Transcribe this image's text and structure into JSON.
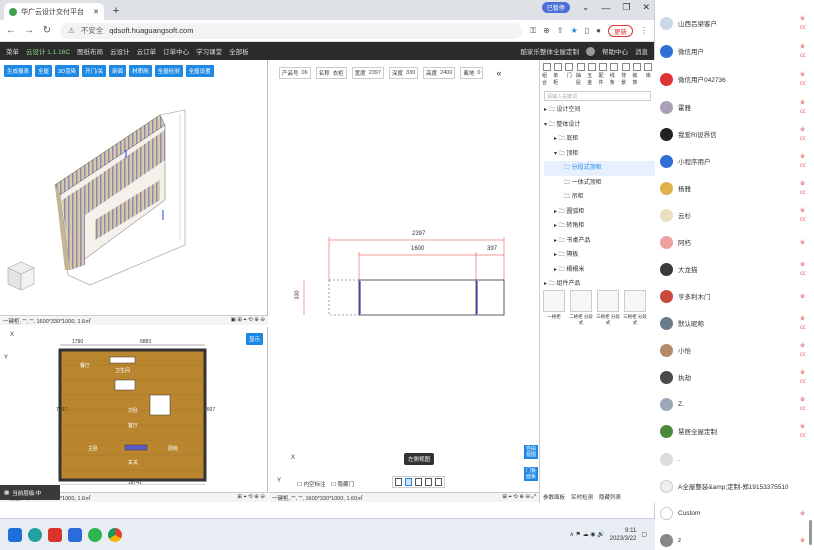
{
  "browser": {
    "tab_title": "华广云设计交付平台",
    "new_tab": "+",
    "url_security": "不安全",
    "url": "qdsoft.huaguangsoft.com",
    "update_label": "更新",
    "profile_label": "已暂停",
    "minimize": "—",
    "restore": "❐",
    "close": "✕"
  },
  "appbar": {
    "menu": "菜单",
    "version": "云设计 1.1.16C",
    "items": [
      "图纸布局",
      "云设计",
      "云订单",
      "订单中心",
      "学习课堂",
      "全部板"
    ],
    "right_items": [
      "酷家乐整体全屋定制",
      "帮助中心",
      "消息"
    ]
  },
  "toolbar3d": [
    "生成报表",
    "全屋",
    "3D渲染",
    "开门/关",
    "剖面",
    "材质刷",
    "全屋检测",
    "全屋设置"
  ],
  "coord_bar": {
    "left": "一键柜, \"\", \"\", 1600*330*1000,  1.6㎡",
    "left2": "一键柜, \"\", \"\", 1600*330*1000,  1.60㎡"
  },
  "plan2d": {
    "dim_top": "1790",
    "dim_top2": "6883",
    "dim_left": "7607",
    "dim_right": "7607",
    "dim_bottom": "18741",
    "rooms": [
      "餐厅",
      "卫生间",
      "次卧",
      "客厅",
      "主卧",
      "厨房",
      "玄关"
    ],
    "toggle_label": "显示"
  },
  "params": {
    "fields": [
      {
        "label": "产品号",
        "value": "06"
      },
      {
        "label": "名称",
        "value": "衣柜"
      },
      {
        "label": "宽度",
        "value": "2397"
      },
      {
        "label": "深度",
        "value": "330"
      },
      {
        "label": "高度",
        "value": "2400"
      },
      {
        "label": "离地",
        "value": "0"
      }
    ]
  },
  "elevation": {
    "dim_total": "2397",
    "dim_a": "1600",
    "dim_b": "397",
    "dim_height": "330",
    "axis_x": "X",
    "axis_y": "Y",
    "check_inner": "内空标注",
    "check_hidden": "隐藏门",
    "tooltip": "左侧视图"
  },
  "right_panel": {
    "categories": [
      "组合",
      "单柜",
      "门",
      "抽屉",
      "五金",
      "配件",
      "线条",
      "背景",
      "装饰",
      "库"
    ],
    "search_placeholder": "请输入关键词",
    "tree": [
      {
        "label": "设计空间",
        "level": 1,
        "selected": false
      },
      {
        "label": "整体设计",
        "level": 1,
        "selected": false
      },
      {
        "label": "底柜",
        "level": 2,
        "selected": false
      },
      {
        "label": "顶柜",
        "level": 2,
        "selected": false
      },
      {
        "label": "分段式顶柜",
        "level": 3,
        "selected": true
      },
      {
        "label": "一体式顶柜",
        "level": 3,
        "selected": false
      },
      {
        "label": "吊柜",
        "level": 3,
        "selected": false
      },
      {
        "label": "圆弧柜",
        "level": 2,
        "selected": false
      },
      {
        "label": "转角柜",
        "level": 2,
        "selected": false
      },
      {
        "label": "书桌产品",
        "level": 2,
        "selected": false
      },
      {
        "label": "隔板",
        "level": 2,
        "selected": false
      },
      {
        "label": "榻榻米",
        "level": 2,
        "selected": false
      },
      {
        "label": "组件产品",
        "level": 1,
        "selected": false
      }
    ],
    "thumbs": [
      "一格柜",
      "二格柜 分段式",
      "三格柜 分段式",
      "三格柜 分段式"
    ],
    "bottom_links": [
      "参数面板",
      "实时检测",
      "隐藏列表"
    ],
    "side_btn1": "自由视图",
    "side_btn2": "门板面板"
  },
  "prevbar": "当前层级:中",
  "taskbar": {
    "time": "9:11",
    "date": "2023/3/22"
  },
  "chat": {
    "items": [
      {
        "name": "山西吕梁客户",
        "mark": "※ ㏄"
      },
      {
        "name": "微信用户",
        "mark": "※ ㏄"
      },
      {
        "name": "微信用户042736",
        "mark": "※ ㏄"
      },
      {
        "name": "霍雅",
        "mark": "※ ㏄"
      },
      {
        "name": "我爱Ri设界信",
        "mark": "※ ㏄"
      },
      {
        "name": "小程序用户",
        "mark": "※ ㏄"
      },
      {
        "name": "杨雅",
        "mark": "※ ㏄"
      },
      {
        "name": "云杉",
        "mark": "※ ㏄"
      },
      {
        "name": "阿朽",
        "mark": "※"
      },
      {
        "name": "大龙猫",
        "mark": "※ ㏄"
      },
      {
        "name": "亨多利木门",
        "mark": "※"
      },
      {
        "name": "默认昵称",
        "mark": "※ ㏄"
      },
      {
        "name": "小怡",
        "mark": "※ ㏄"
      },
      {
        "name": "执劫",
        "mark": "※ ㏄"
      },
      {
        "name": "Z.",
        "mark": "※ ㏄"
      },
      {
        "name": "慧居全屋定制",
        "mark": "※ ㏄"
      },
      {
        "name": ".",
        "mark": ""
      },
      {
        "name": "A全屋整装&amp;定制-郑19153375510",
        "mark": ""
      },
      {
        "name": "Custom",
        "mark": "※"
      },
      {
        "name": "z",
        "mark": "※"
      }
    ]
  },
  "colors": {
    "accent": "#1e88e5",
    "dim_red": "#e53935",
    "floor": "#b9862f",
    "chat_mark": "#e05555"
  }
}
